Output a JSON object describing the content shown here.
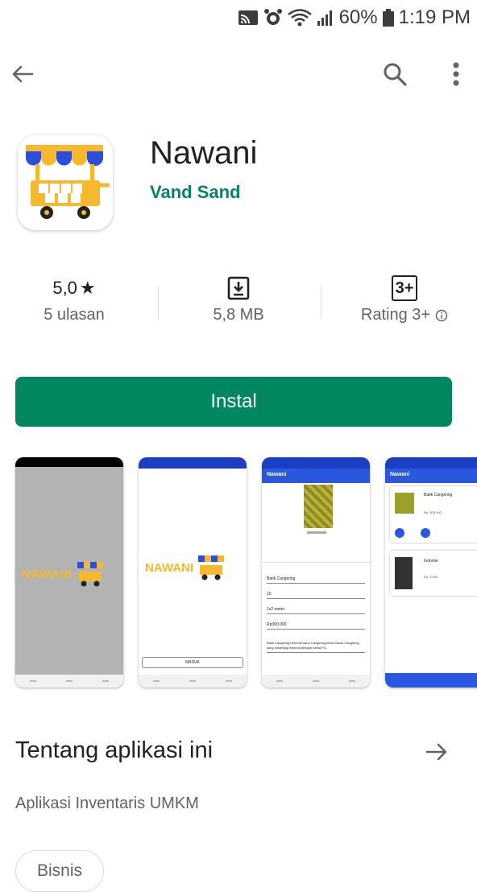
{
  "status_bar": {
    "battery_percent": "60%",
    "time": "1:19 PM"
  },
  "app": {
    "title": "Nawani",
    "developer": "Vand Sand",
    "icon_name": "nawani-cart-icon"
  },
  "stats": {
    "rating_value": "5,0",
    "rating_star": "★",
    "reviews_label": "5 ulasan",
    "size_label": "5,8 MB",
    "age_badge": "3+",
    "age_label": "Rating 3+"
  },
  "install_label": "Instal",
  "screenshots": {
    "splash_brand": "NAWANI",
    "login_brand": "NAWANI",
    "login_button": "MASUK",
    "form_title": "Nawani",
    "list_title": "Nawani",
    "list_item_1": "Batik Cangkring",
    "list_item_1_price": "Rp. 300.000",
    "list_item_2": "Indomie",
    "list_item_2_price": "Rp. 3.000",
    "form_fields": [
      "Batik Cangkring",
      "10",
      "1x2 meter",
      "Rp300.000"
    ],
    "form_desc": "Batik Cangkring bermotif daun Cangkring khas Dusun Cangkring yang sekarang terkenal dengan nama Pa"
  },
  "about": {
    "title": "Tentang aplikasi ini",
    "description": "Aplikasi Inventaris UMKM",
    "category_chip": "Bisnis"
  },
  "colors": {
    "accent": "#01875f",
    "shot_blue": "#2a57e0",
    "cart_yellow": "#f5b82e",
    "awning_blue": "#2d4fd8"
  }
}
